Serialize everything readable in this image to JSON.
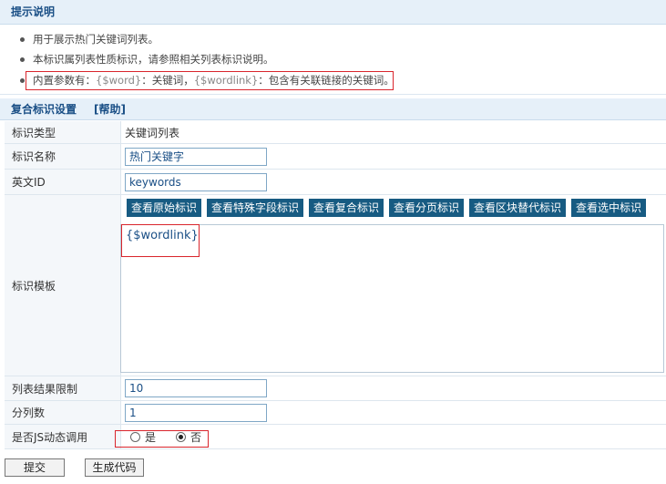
{
  "tips": {
    "title": "提示说明",
    "items": [
      "用于展示热门关键词列表。",
      "本标识属列表性质标识，请参照相关列表标识说明。"
    ],
    "params": {
      "prefix": "内置参数有：",
      "p1": "{$word}",
      "p1_desc": "：关键词，",
      "p2": "{$wordlink}",
      "p2_desc": "：包含有关联链接的关键词。"
    }
  },
  "form": {
    "title": "复合标识设置",
    "help": "[帮助]",
    "rows": {
      "type_label": "标识类型",
      "type_value": "关键词列表",
      "name_label": "标识名称",
      "name_value": "热门关键字",
      "id_label": "英文ID",
      "id_value": "keywords",
      "tpl_label": "标识模板",
      "tpl_value": "{$wordlink}",
      "limit_label": "列表结果限制",
      "limit_value": "10",
      "cols_label": "分列数",
      "cols_value": "1",
      "js_label": "是否JS动态调用",
      "js_yes": "是",
      "js_no": "否"
    },
    "tpl_buttons": [
      "查看原始标识",
      "查看特殊字段标识",
      "查看复合标识",
      "查看分页标识",
      "查看区块替代标识",
      "查看选中标识"
    ]
  },
  "actions": {
    "submit": "提交",
    "generate": "生成代码"
  }
}
